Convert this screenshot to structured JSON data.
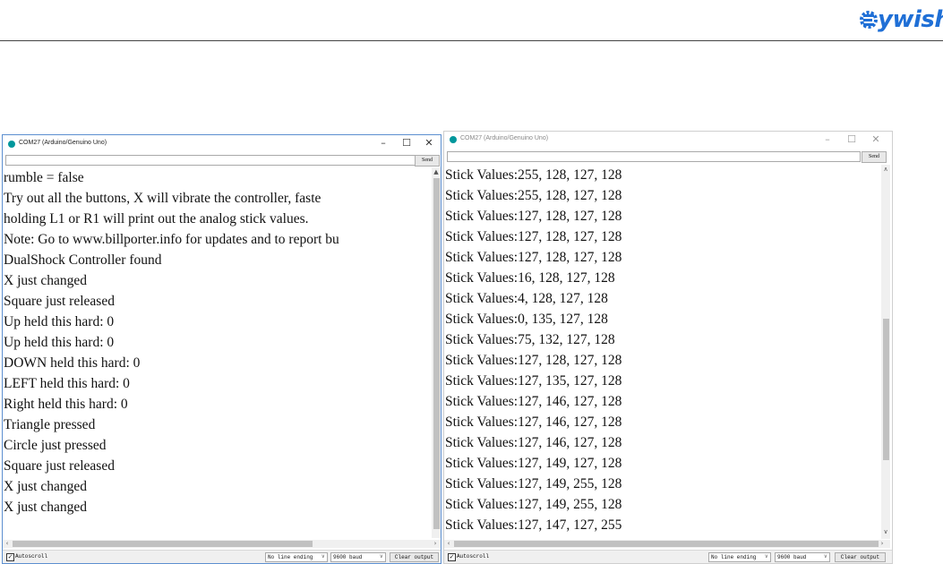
{
  "brand": {
    "logo_text": "ywish"
  },
  "left_window": {
    "title": "COM27 (Arduino/Genuino Uno)",
    "send_label": "Send",
    "input_value": "",
    "output_lines": [
      "rumble = false",
      "Try out all the buttons, X will vibrate the controller, faste",
      "holding L1 or R1 will print out the analog stick values.",
      "Note: Go to www.billporter.info for updates and to report bu",
      "DualShock Controller found",
      "X just changed",
      "Square just released",
      "Up held this hard: 0",
      "Up held this hard: 0",
      "DOWN held this hard: 0",
      "LEFT held this hard: 0",
      "Right held this hard: 0",
      "Triangle pressed",
      "Circle just pressed",
      "Square just released",
      "X just changed",
      "X just changed"
    ],
    "autoscroll_label": "Autoscroll",
    "autoscroll_checked": true,
    "line_ending": "No line ending",
    "baud": "9600 baud",
    "clear_label": "Clear output"
  },
  "right_window": {
    "title": "COM27 (Arduino/Genuino Uno)",
    "send_label": "Send",
    "input_value": "",
    "output_lines": [
      "Stick Values:255, 128, 127, 128",
      "Stick Values:255, 128, 127, 128",
      "Stick Values:127, 128, 127, 128",
      "Stick Values:127, 128, 127, 128",
      "Stick Values:127, 128, 127, 128",
      "Stick Values:16, 128, 127, 128",
      "Stick Values:4, 128, 127, 128",
      "Stick Values:0, 135, 127, 128",
      "Stick Values:75, 132, 127, 128",
      "Stick Values:127, 128, 127, 128",
      "Stick Values:127, 135, 127, 128",
      "Stick Values:127, 146, 127, 128",
      "Stick Values:127, 146, 127, 128",
      "Stick Values:127, 146, 127, 128",
      "Stick Values:127, 149, 127, 128",
      "Stick Values:127, 149, 255, 128",
      "Stick Values:127, 149, 255, 128",
      "Stick Values:127, 147, 127, 255"
    ],
    "autoscroll_label": "Autoscroll",
    "autoscroll_checked": true,
    "line_ending": "No line ending",
    "baud": "9600 baud",
    "clear_label": "Clear output"
  },
  "icons": {
    "minimize": "minimize-icon",
    "maximize": "maximize-icon",
    "close": "close-icon",
    "app": "arduino-icon",
    "check": "checkmark-icon"
  },
  "colors": {
    "accent": "#00979c",
    "logo": "#1f6fd6"
  }
}
